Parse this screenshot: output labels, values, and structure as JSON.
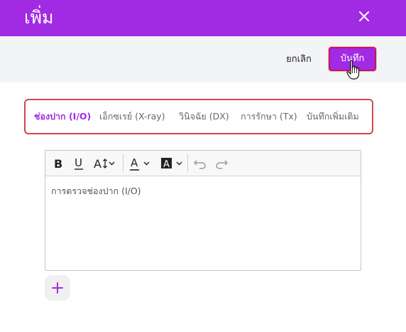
{
  "dialog": {
    "title": "เพิ่ม",
    "close_icon": "close-icon"
  },
  "actions": {
    "cancel_label": "ยกเลิก",
    "save_label": "บันทึก"
  },
  "tabs": [
    {
      "label": "ช่องปาก (I/O)",
      "active": true
    },
    {
      "label": "เอ็กซเรย์ (X-ray)",
      "active": false
    },
    {
      "label": "วินิจฉัย (DX)",
      "active": false
    },
    {
      "label": "การรักษา (Tx)",
      "active": false
    },
    {
      "label": "บันทึกเพิ่มเติม",
      "active": false
    }
  ],
  "editor": {
    "toolbar": [
      "bold-icon",
      "underline-icon",
      "font-size-icon",
      "font-color-icon",
      "highlight-color-icon",
      "undo-icon",
      "redo-icon"
    ],
    "content": "การตรวจช่องปาก (I/O)"
  },
  "colors": {
    "primary": "#a12be3",
    "save_border": "#c2185b",
    "tabs_border": "#d0474f"
  }
}
